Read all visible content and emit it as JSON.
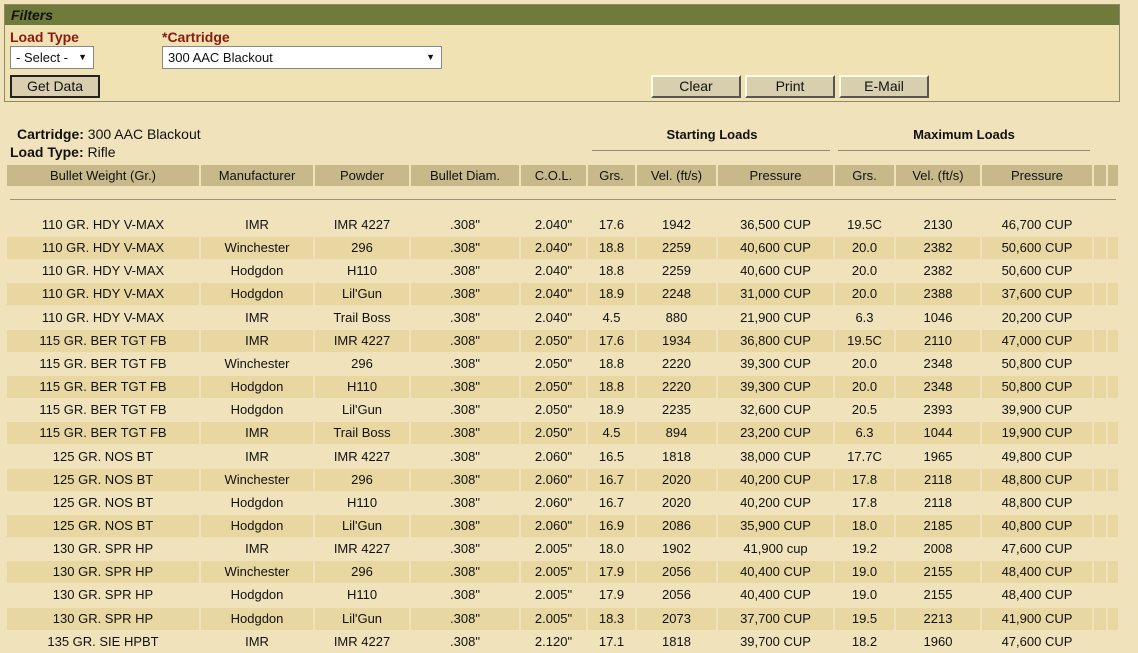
{
  "filters": {
    "title": "Filters",
    "load_type_label": "Load Type",
    "load_type_value": "- Select -",
    "cartridge_label": "*Cartridge",
    "cartridge_value": "300 AAC Blackout",
    "get_data": "Get Data",
    "clear": "Clear",
    "print": "Print",
    "email": "E-Mail"
  },
  "info": {
    "cartridge_label": "Cartridge:",
    "cartridge_value": "300 AAC Blackout",
    "load_type_label": "Load Type:",
    "load_type_value": "Rifle",
    "starting_loads": "Starting Loads",
    "maximum_loads": "Maximum Loads"
  },
  "columns": [
    "Bullet Weight (Gr.)",
    "Manufacturer",
    "Powder",
    "Bullet Diam.",
    "C.O.L.",
    "Grs.",
    "Vel. (ft/s)",
    "Pressure",
    "Grs.",
    "Vel. (ft/s)",
    "Pressure"
  ],
  "rows": [
    [
      "110 GR. HDY V-MAX",
      "IMR",
      "IMR 4227",
      ".308\"",
      "2.040\"",
      "17.6",
      "1942",
      "36,500 CUP",
      "19.5C",
      "2130",
      "46,700 CUP"
    ],
    [
      "110 GR. HDY V-MAX",
      "Winchester",
      "296",
      ".308\"",
      "2.040\"",
      "18.8",
      "2259",
      "40,600 CUP",
      "20.0",
      "2382",
      "50,600 CUP"
    ],
    [
      "110 GR. HDY V-MAX",
      "Hodgdon",
      "H110",
      ".308\"",
      "2.040\"",
      "18.8",
      "2259",
      "40,600 CUP",
      "20.0",
      "2382",
      "50,600 CUP"
    ],
    [
      "110 GR. HDY V-MAX",
      "Hodgdon",
      "Lil'Gun",
      ".308\"",
      "2.040\"",
      "18.9",
      "2248",
      "31,000 CUP",
      "20.0",
      "2388",
      "37,600 CUP"
    ],
    [
      "110 GR. HDY V-MAX",
      "IMR",
      "Trail Boss",
      ".308\"",
      "2.040\"",
      "4.5",
      "880",
      "21,900 CUP",
      "6.3",
      "1046",
      "20,200 CUP"
    ],
    [
      "115 GR. BER TGT FB",
      "IMR",
      "IMR 4227",
      ".308\"",
      "2.050\"",
      "17.6",
      "1934",
      "36,800 CUP",
      "19.5C",
      "2110",
      "47,000 CUP"
    ],
    [
      "115 GR. BER TGT FB",
      "Winchester",
      "296",
      ".308\"",
      "2.050\"",
      "18.8",
      "2220",
      "39,300 CUP",
      "20.0",
      "2348",
      "50,800 CUP"
    ],
    [
      "115 GR. BER TGT FB",
      "Hodgdon",
      "H110",
      ".308\"",
      "2.050\"",
      "18.8",
      "2220",
      "39,300 CUP",
      "20.0",
      "2348",
      "50,800 CUP"
    ],
    [
      "115 GR. BER TGT FB",
      "Hodgdon",
      "Lil'Gun",
      ".308\"",
      "2.050\"",
      "18.9",
      "2235",
      "32,600 CUP",
      "20.5",
      "2393",
      "39,900 CUP"
    ],
    [
      "115 GR. BER TGT FB",
      "IMR",
      "Trail Boss",
      ".308\"",
      "2.050\"",
      "4.5",
      "894",
      "23,200 CUP",
      "6.3",
      "1044",
      "19,900 CUP"
    ],
    [
      "125 GR. NOS BT",
      "IMR",
      "IMR 4227",
      ".308\"",
      "2.060\"",
      "16.5",
      "1818",
      "38,000 CUP",
      "17.7C",
      "1965",
      "49,800 CUP"
    ],
    [
      "125 GR. NOS BT",
      "Winchester",
      "296",
      ".308\"",
      "2.060\"",
      "16.7",
      "2020",
      "40,200 CUP",
      "17.8",
      "2118",
      "48,800 CUP"
    ],
    [
      "125 GR. NOS BT",
      "Hodgdon",
      "H110",
      ".308\"",
      "2.060\"",
      "16.7",
      "2020",
      "40,200 CUP",
      "17.8",
      "2118",
      "48,800 CUP"
    ],
    [
      "125 GR. NOS BT",
      "Hodgdon",
      "Lil'Gun",
      ".308\"",
      "2.060\"",
      "16.9",
      "2086",
      "35,900 CUP",
      "18.0",
      "2185",
      "40,800 CUP"
    ],
    [
      "130 GR. SPR HP",
      "IMR",
      "IMR 4227",
      ".308\"",
      "2.005\"",
      "18.0",
      "1902",
      "41,900 cup",
      "19.2",
      "2008",
      "47,600 CUP"
    ],
    [
      "130 GR. SPR HP",
      "Winchester",
      "296",
      ".308\"",
      "2.005\"",
      "17.9",
      "2056",
      "40,400 CUP",
      "19.0",
      "2155",
      "48,400 CUP"
    ],
    [
      "130 GR. SPR HP",
      "Hodgdon",
      "H110",
      ".308\"",
      "2.005\"",
      "17.9",
      "2056",
      "40,400 CUP",
      "19.0",
      "2155",
      "48,400 CUP"
    ],
    [
      "130 GR. SPR HP",
      "Hodgdon",
      "Lil'Gun",
      ".308\"",
      "2.005\"",
      "18.3",
      "2073",
      "37,700 CUP",
      "19.5",
      "2213",
      "41,900 CUP"
    ],
    [
      "135 GR. SIE HPBT",
      "IMR",
      "IMR 4227",
      ".308\"",
      "2.120\"",
      "17.1",
      "1818",
      "39,700 CUP",
      "18.2",
      "1960",
      "47,600 CUP"
    ]
  ]
}
